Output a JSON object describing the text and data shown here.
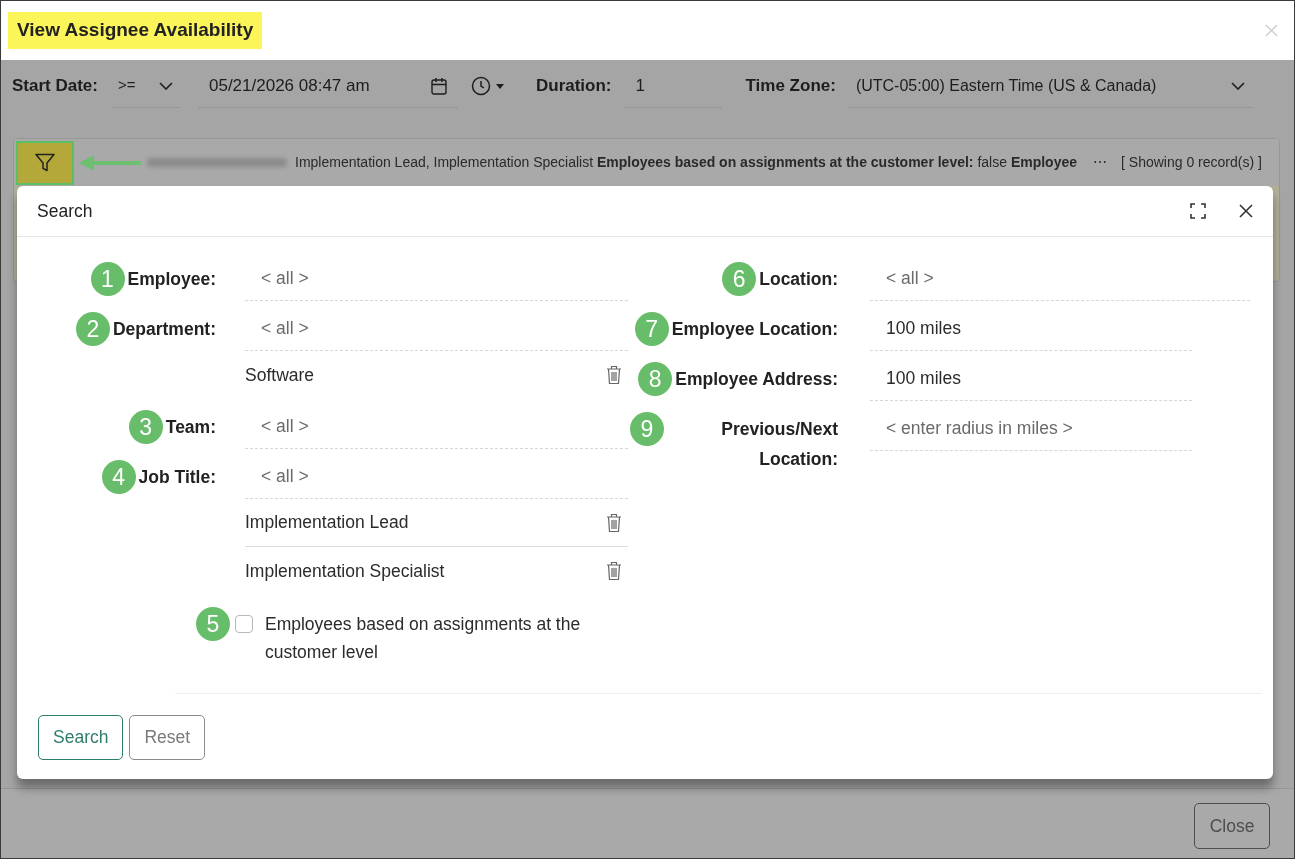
{
  "window": {
    "title": "View Assignee Availability"
  },
  "toolbar": {
    "start_date": {
      "label": "Start Date:",
      "operator": ">=",
      "value": "05/21/2026 08:47 am"
    },
    "duration": {
      "label": "Duration:",
      "value": "1"
    },
    "time_zone": {
      "label": "Time Zone:",
      "value": "(UTC-05:00) Eastern Time (US & Canada)"
    }
  },
  "filter_bar": {
    "summary": "Implementation Lead, Implementation Specialist **Employees based on assignments at the customer level:** false **Employee**",
    "more": "⋯",
    "record_count": "[ Showing 0 record(s) ]"
  },
  "search_dialog": {
    "title": "Search",
    "left_fields": [
      {
        "kind": "lookup",
        "marker": "1",
        "label": "Employee:",
        "placeholder": "< all >"
      },
      {
        "kind": "lookup",
        "marker": "2",
        "label": "Department:",
        "placeholder": "< all >",
        "selected_items": [
          "Software"
        ]
      },
      {
        "kind": "lookup",
        "marker": "3",
        "label": "Team:",
        "placeholder": "< all >"
      },
      {
        "kind": "lookup",
        "marker": "4",
        "label": "Job Title:",
        "placeholder": "< all >",
        "selected_items": [
          "Implementation Lead",
          "Implementation Specialist"
        ]
      },
      {
        "kind": "checkbox",
        "marker": "5",
        "label": "Employees based on assignments at the customer level",
        "checked": false
      }
    ],
    "right_fields": [
      {
        "kind": "lookup",
        "marker": "6",
        "label": "Location:",
        "placeholder": "< all >"
      },
      {
        "kind": "radius",
        "marker": "7",
        "label": "Employee Location:",
        "value": "100 miles"
      },
      {
        "kind": "radius",
        "marker": "8",
        "label": "Employee Address:",
        "value": "100 miles"
      },
      {
        "kind": "radius",
        "marker": "9",
        "label": "Previous/Next Location:",
        "placeholder": "< enter radius in miles >"
      }
    ],
    "buttons": [
      {
        "label": "Search",
        "kind": "primary"
      },
      {
        "label": "Reset",
        "kind": "secondary"
      }
    ]
  },
  "footer": {
    "buttons": [
      {
        "label": "Close",
        "kind": "secondary"
      }
    ]
  }
}
